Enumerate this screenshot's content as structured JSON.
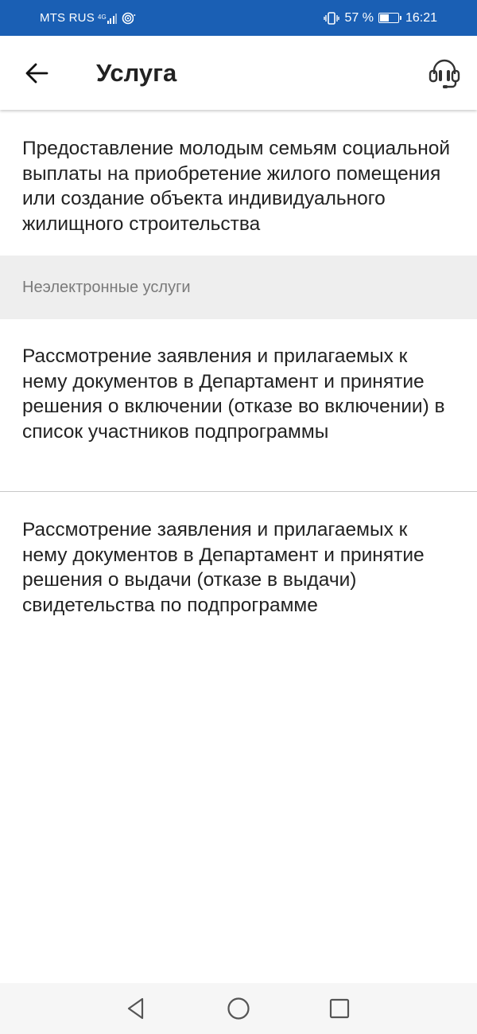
{
  "status_bar": {
    "carrier": "MTS RUS",
    "network_type": "4G",
    "battery_percent": "57 %",
    "battery_level": 0.57,
    "time": "16:21",
    "color": "#1a5fb4"
  },
  "app_bar": {
    "title": "Услуга",
    "back_icon": "arrow-left-icon",
    "support_icon": "headset-icon"
  },
  "service": {
    "title": "Предоставление  молодым семьям социальной выплаты на приобретение жилого помещения или создание объекта индивидуального жилищного строительства"
  },
  "section": {
    "header": "Неэлектронные услуги",
    "items": [
      {
        "label": "Рассмотрение заявления и прилагаемых к нему документов в Департамент и принятие решения о включении (отказе во включении) в список участников подпрограммы"
      },
      {
        "label": "Рассмотрение заявления и прилагаемых к нему документов в Департамент и принятие решения о выдачи (отказе в выдачи) свидетельства по подпрограмме"
      }
    ]
  },
  "nav_bar": {
    "back_icon": "triangle-back-icon",
    "home_icon": "circle-home-icon",
    "recents_icon": "square-recents-icon"
  }
}
